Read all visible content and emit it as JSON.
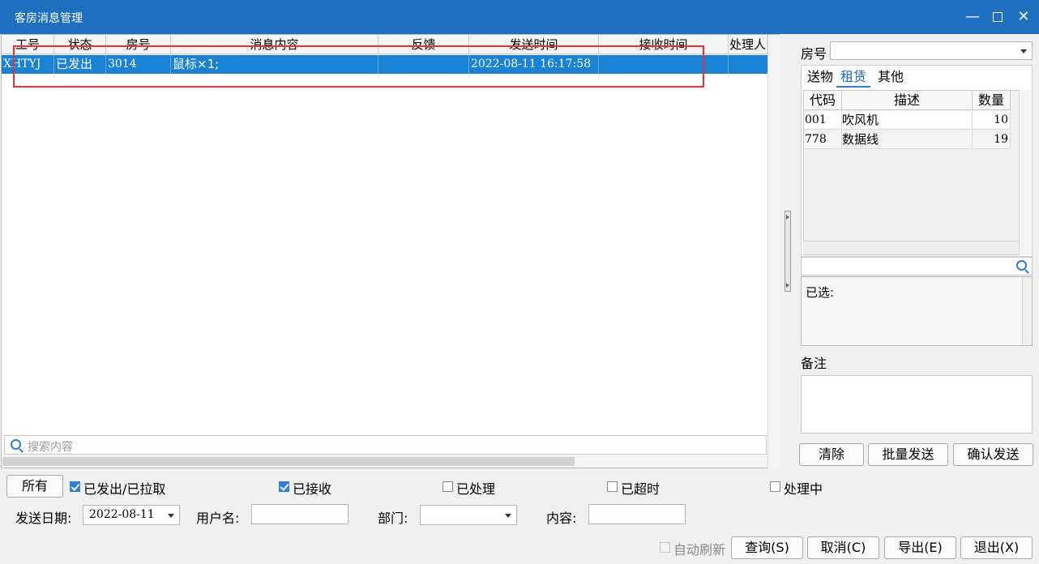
{
  "window": {
    "title": "客房消息管理",
    "minimize_icon": "minimize-icon",
    "maximize_icon": "maximize-icon",
    "close_icon": "close-icon"
  },
  "grid": {
    "columns": [
      "工号",
      "状态",
      "房号",
      "消息内容",
      "反馈",
      "发送时间",
      "接收时间",
      "处理人"
    ],
    "rows": [
      {
        "employee_id": "XHTYJ",
        "status": "已发出",
        "room": "3014",
        "content": "鼠标×1;",
        "feedback": "",
        "send_time": "2022-08-11 16:17:58",
        "receive_time": "",
        "handler": ""
      }
    ],
    "search_placeholder": "搜索内容",
    "selected_row_color": "#1a82d4",
    "highlight_box_color": "#e0343a"
  },
  "right": {
    "room_label": "房号",
    "room_value": "",
    "tabs": [
      {
        "label": "送物"
      },
      {
        "label": "租赁"
      },
      {
        "label": "其他"
      }
    ],
    "active_tab": "租赁",
    "item_columns": [
      "代码",
      "描述",
      "数量"
    ],
    "items": [
      {
        "code": "001",
        "desc": "吹风机",
        "qty": "10"
      },
      {
        "code": "778",
        "desc": "数据线",
        "qty": "19"
      }
    ],
    "selected_label": "已选:",
    "note_label": "备注",
    "buttons": {
      "clear": "清除",
      "batch_send": "批量发送",
      "confirm_send": "确认发送"
    }
  },
  "filters": {
    "all_button": "所有",
    "checkboxes": [
      {
        "label": "已发出/已拉取",
        "checked": true
      },
      {
        "label": "已接收",
        "checked": true
      },
      {
        "label": "已处理",
        "checked": false
      },
      {
        "label": "已超时",
        "checked": false
      },
      {
        "label": "处理中",
        "checked": false
      }
    ],
    "send_date_label": "发送日期:",
    "send_date_value": "2022-08-11",
    "username_label": "用户名:",
    "department_label": "部门:",
    "content_label": "内容:"
  },
  "footer": {
    "auto_refresh_label": "自动刷新",
    "query_button": "查询(S)",
    "cancel_button": "取消(C)",
    "export_button": "导出(E)",
    "exit_button": "退出(X)"
  }
}
